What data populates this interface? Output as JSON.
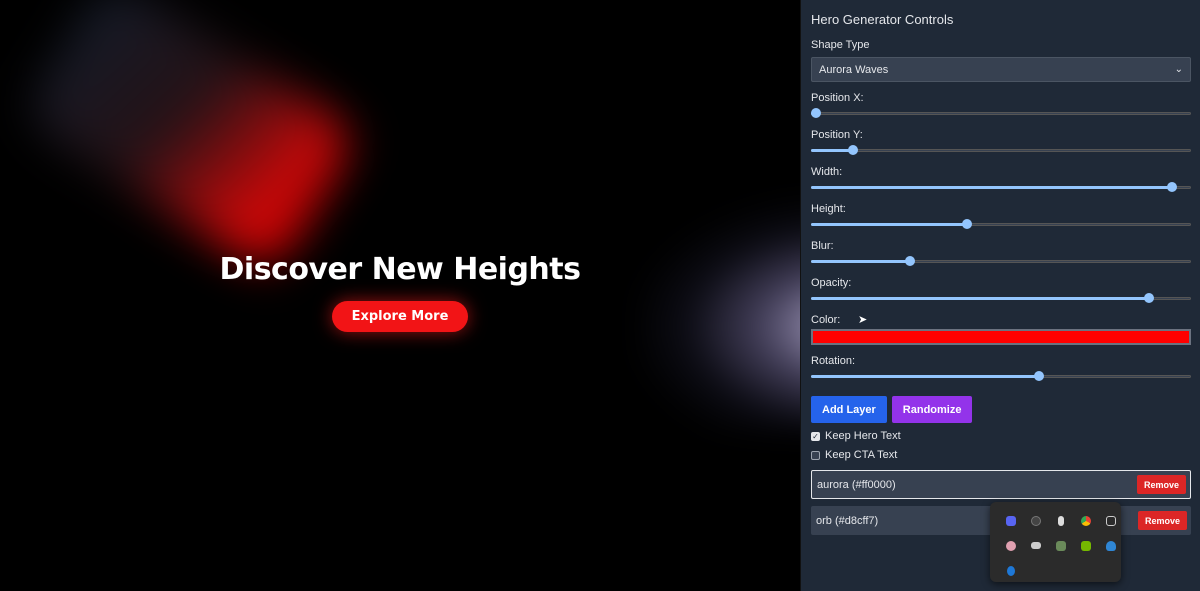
{
  "hero": {
    "title": "Discover New Heights",
    "cta_label": "Explore More"
  },
  "panel": {
    "title": "Hero Generator Controls",
    "shape_type_label": "Shape Type",
    "shape_type_value": "Aurora Waves",
    "sliders": [
      {
        "label": "Position X:",
        "value": 0.01
      },
      {
        "label": "Position Y:",
        "value": 0.11
      },
      {
        "label": "Width:",
        "value": 0.95
      },
      {
        "label": "Height:",
        "value": 0.41
      },
      {
        "label": "Blur:",
        "value": 0.26
      },
      {
        "label": "Opacity:",
        "value": 0.89
      },
      {
        "label": "Color:",
        "value": null
      },
      {
        "label": "Rotation:",
        "value": 0.6
      }
    ],
    "color_value": "#ff0000",
    "add_layer_label": "Add Layer",
    "randomize_label": "Randomize",
    "keep_hero_text_label": "Keep Hero Text",
    "keep_hero_text_checked": true,
    "keep_cta_text_label": "Keep CTA Text",
    "keep_cta_text_checked": false,
    "layers": [
      {
        "label": "aurora (#ff0000)",
        "remove_label": "Remove"
      },
      {
        "label": "orb (#d8cff7)",
        "remove_label": "Remove"
      }
    ]
  },
  "tray": {
    "icons": [
      "discord-icon",
      "circle-app-icon",
      "figure-icon",
      "chrome-icon",
      "screen-icon",
      "gear-flower-icon",
      "cup-icon",
      "image-icon",
      "nvidia-icon",
      "onedrive-icon",
      "bluetooth-icon"
    ]
  },
  "colors": {
    "accent_red": "#f21416",
    "panel_bg": "#1f2937",
    "slider_blue": "#93c5fd",
    "add_layer": "#2563eb",
    "randomize": "#9333ea",
    "remove": "#dc2626"
  }
}
